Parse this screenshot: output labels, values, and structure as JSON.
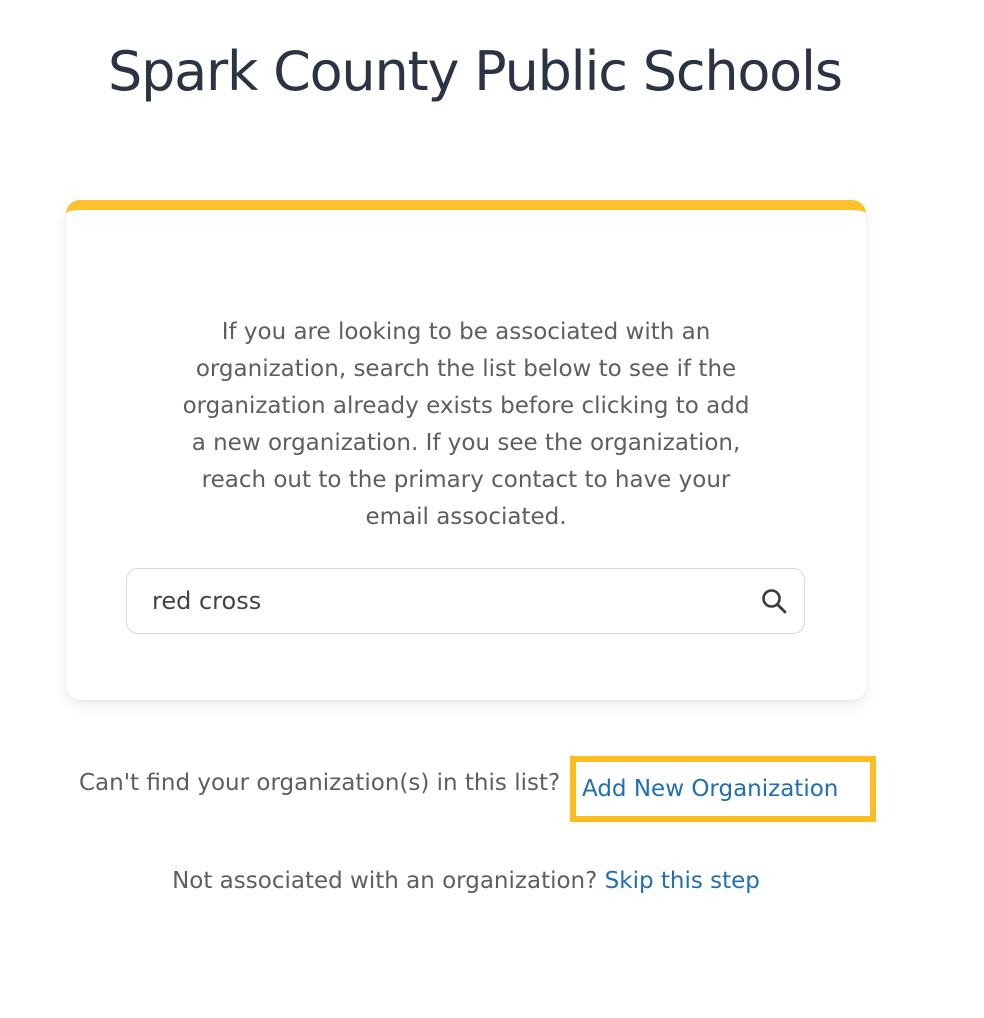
{
  "header": {
    "title": "Spark County Public Schools"
  },
  "card": {
    "instructions": "If you are looking to be associated with an organization, search the list below to see if the organization already exists before clicking to add a new organization. If you see the organization, reach out to the primary contact to have your email associated.",
    "search": {
      "value": "red cross",
      "icon": "search-icon"
    }
  },
  "footer": {
    "add_prompt": "Can't find your organization(s) in this list?",
    "add_link": "Add New Organization",
    "skip_prompt": "Not associated with an organization?",
    "skip_link": "Skip this step"
  },
  "colors": {
    "accent": "#fcc12d",
    "link": "#1f6fb2",
    "title": "#2b3445",
    "body_text": "#5e5e5e"
  }
}
